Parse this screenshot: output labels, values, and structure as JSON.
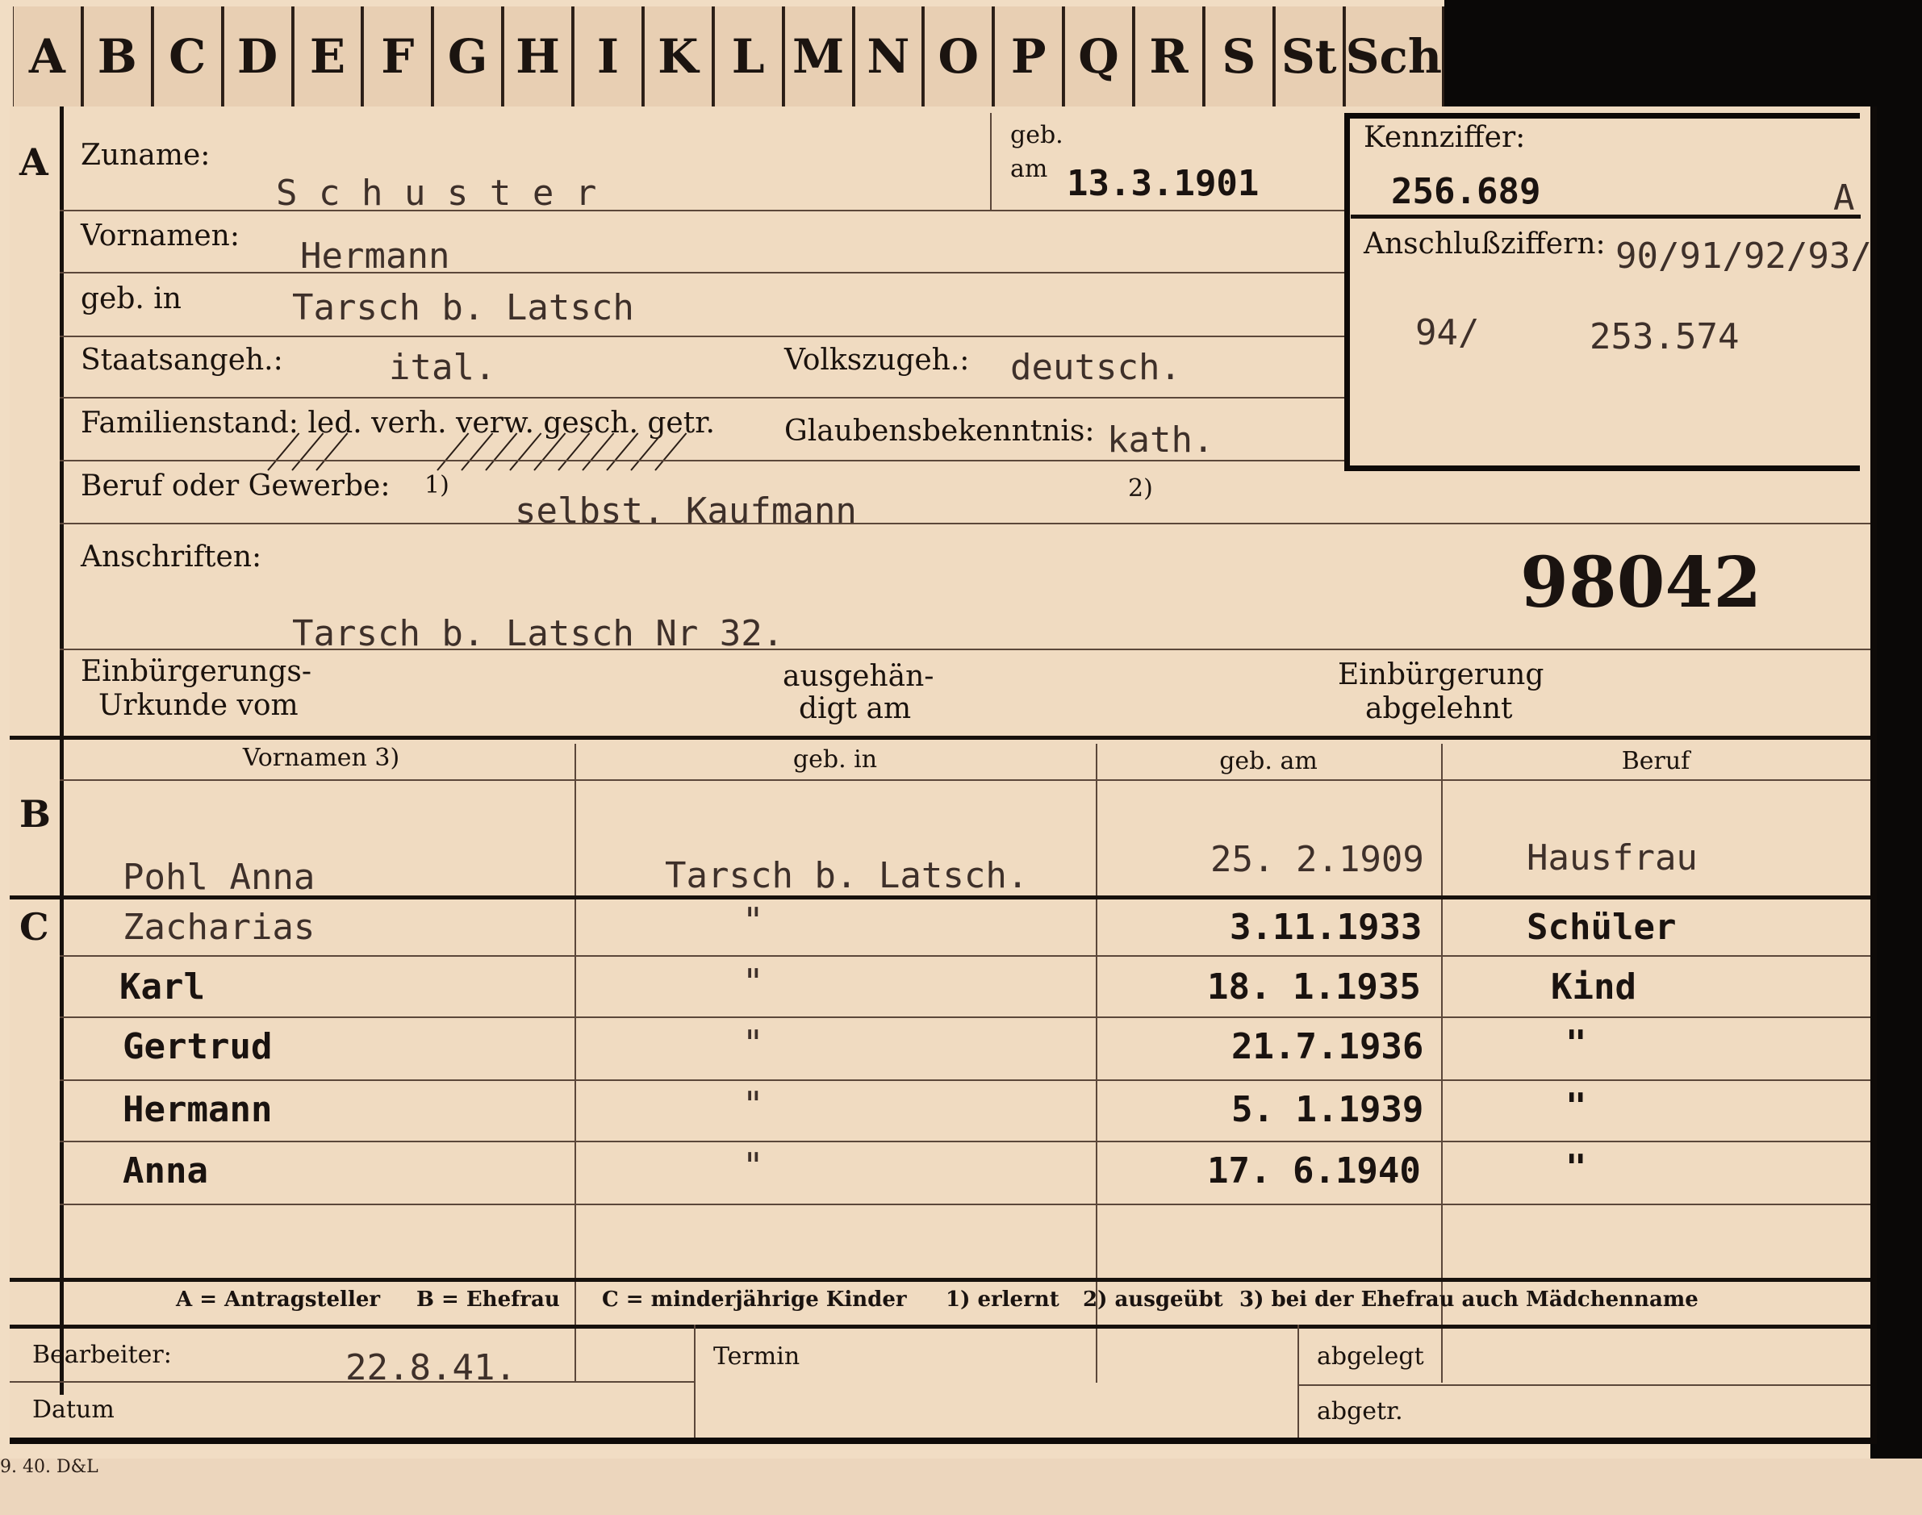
{
  "alphabet_tabs": [
    "A",
    "B",
    "C",
    "D",
    "E",
    "F",
    "G",
    "H",
    "I",
    "K",
    "L",
    "M",
    "N",
    "O",
    "P",
    "Q",
    "R",
    "S",
    "St",
    "Sch"
  ],
  "section_markers": {
    "a": "A",
    "b": "B",
    "c": "C"
  },
  "applicant": {
    "surname_label": "Zuname:",
    "surname": "S c h u s t e r",
    "born_label_1": "geb.",
    "born_label_2": "am",
    "birth_date": "13.3.1901",
    "id_label": "Kennziffer:",
    "id_number": "256.689",
    "id_suffix": "A",
    "first_names_label": "Vornamen:",
    "first_names": "Hermann",
    "connection_label": "Anschlußziffern:",
    "connection_numbers_line1": "90/91/92/93/",
    "connection_numbers_line2a": "94/",
    "connection_numbers_line2b": "253.574",
    "birthplace_label": "geb. in",
    "birthplace": "Tarsch b. Latsch",
    "citizenship_label": "Staatsangeh.:",
    "citizenship": "ital.",
    "ethnicity_label": "Volkszugeh.:",
    "ethnicity": "deutsch.",
    "marital_label": "Familienstand: led. verh. verw. gesch. getr.",
    "religion_label": "Glaubensbekenntnis:",
    "religion": "kath.",
    "occupation_label": "Beruf oder Gewerbe:",
    "footnote_1": "1)",
    "occupation": "selbst. Kaufmann",
    "footnote_2": "2)",
    "address_label": "Anschriften:",
    "address": "Tarsch b. Latsch Nr 32.",
    "file_number": "98042",
    "naturalization_label_1": "Einbürgerungs-",
    "naturalization_label_2": "Urkunde vom",
    "handed_label_1": "ausgehän-",
    "handed_label_2": "digt am",
    "rejected_label_1": "Einbürgerung",
    "rejected_label_2": "abgelehnt"
  },
  "family_table": {
    "headers": [
      "Vornamen 3)",
      "geb. in",
      "geb. am",
      "Beruf"
    ],
    "spouse": {
      "name": "Pohl   Anna",
      "birthplace": "Tarsch  b. Latsch.",
      "birth_date": "25. 2.1909",
      "occupation": "Hausfrau"
    },
    "children": [
      {
        "name": "Zacharias",
        "birthplace": "\"",
        "birth_date": "3.11.1933",
        "occupation": "Schüler"
      },
      {
        "name": "Karl",
        "birthplace": "\"",
        "birth_date": "18. 1.1935",
        "occupation": "Kind"
      },
      {
        "name": "Gertrud",
        "birthplace": "\"",
        "birth_date": "21.7.1936",
        "occupation": "\""
      },
      {
        "name": "Hermann",
        "birthplace": "\"",
        "birth_date": "5. 1.1939",
        "occupation": "\""
      },
      {
        "name": "Anna",
        "birthplace": "\"",
        "birth_date": "17. 6.1940",
        "occupation": "\""
      }
    ]
  },
  "legend": {
    "text_a": "A = Antragsteller",
    "text_b": "B = Ehefrau",
    "text_c": "C = minderjährige Kinder",
    "text_1": "1) erlernt",
    "text_2": "2) ausgeübt",
    "text_3": "3) bei der Ehefrau auch Mädchenname"
  },
  "footer": {
    "clerk_label": "Bearbeiter:",
    "date_value": "22.8.41.",
    "date_label": "Datum",
    "deadline_label": "Termin",
    "filed_label": "abgelegt",
    "filed_short_label": "abgetr.",
    "print_code": "9. 40. D&L"
  }
}
